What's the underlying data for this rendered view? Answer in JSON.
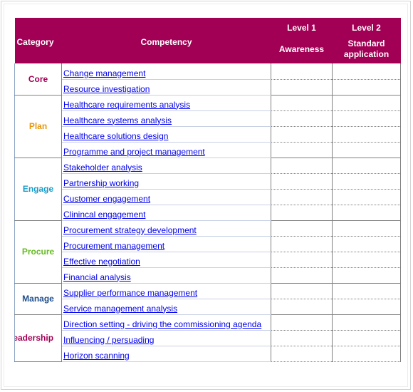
{
  "header": {
    "category": "Category",
    "competency": "Competency",
    "level1": {
      "level": "Level 1",
      "name": "Awareness"
    },
    "level2": {
      "level": "Level 2",
      "name_line1": "Standard",
      "name_line2": "application"
    }
  },
  "colors": {
    "header_bg": "#a20055",
    "link": "#0000ee"
  },
  "groups": [
    {
      "category": "Core",
      "color": "#a20055",
      "competencies": [
        "Change management",
        "Resource investigation"
      ]
    },
    {
      "category": "Plan",
      "color": "#e8960a",
      "competencies": [
        "Healthcare requirements analysis",
        "Healthcare systems analysis",
        "Healthcare solutions design",
        "Programme and project management"
      ]
    },
    {
      "category": "Engage",
      "color": "#1a9bc8",
      "competencies": [
        "Stakeholder analysis",
        "Partnership working",
        "Customer engagement",
        "Clinincal engagement"
      ]
    },
    {
      "category": "Procure",
      "color": "#66bb22",
      "competencies": [
        "Procurement strategy development",
        "Procurement management",
        "Effective negotiation",
        "Financial analysis"
      ]
    },
    {
      "category": "Manage",
      "color": "#1f4e8c",
      "competencies": [
        "Supplier performance management",
        "Service management analysis"
      ]
    },
    {
      "category": ".eadership",
      "color": "#a20055",
      "competencies": [
        "Direction setting - driving the commissioning agenda",
        "Influencing / persuading",
        "Horizon scanning"
      ]
    }
  ]
}
